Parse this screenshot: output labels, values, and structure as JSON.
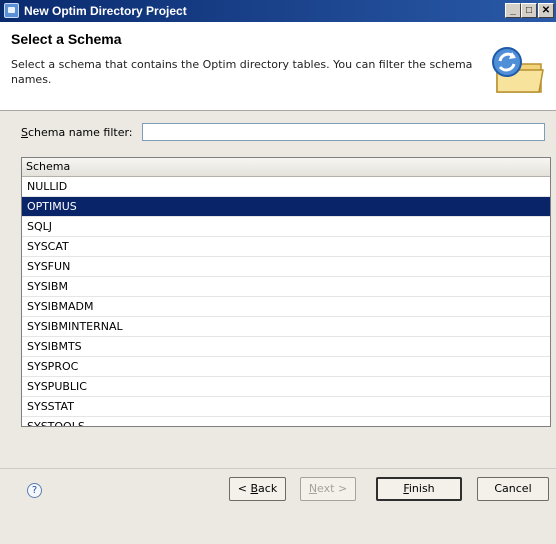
{
  "window": {
    "title": "New Optim Directory Project",
    "controls": {
      "minimize": "_",
      "maximize": "□",
      "close": "✕"
    }
  },
  "header": {
    "title": "Select a Schema",
    "description": "Select a schema that contains the Optim directory tables. You can filter the schema names."
  },
  "filter": {
    "label_mnemonic": "S",
    "label_rest": "chema name filter:",
    "value": ""
  },
  "table": {
    "column": "Schema",
    "selected_index": 1,
    "rows": [
      "NULLID",
      "OPTIMUS",
      "SQLJ",
      "SYSCAT",
      "SYSFUN",
      "SYSIBM",
      "SYSIBMADM",
      "SYSIBMINTERNAL",
      "SYSIBMTS",
      "SYSPROC",
      "SYSPUBLIC",
      "SYSSTAT",
      "SYSTOOLS"
    ]
  },
  "buttons": {
    "help": "?",
    "back_prefix": "< ",
    "back_mnemonic": "B",
    "back_rest": "ack",
    "next_mnemonic": "N",
    "next_rest": "ext >",
    "finish_mnemonic": "F",
    "finish_rest": "inish",
    "cancel": "Cancel"
  },
  "icons": {
    "app": "app-icon",
    "wizard": "folder-refresh-icon",
    "help": "help-icon"
  },
  "colors": {
    "title_bar": "#0a2a6e",
    "selection": "#0a246a"
  }
}
